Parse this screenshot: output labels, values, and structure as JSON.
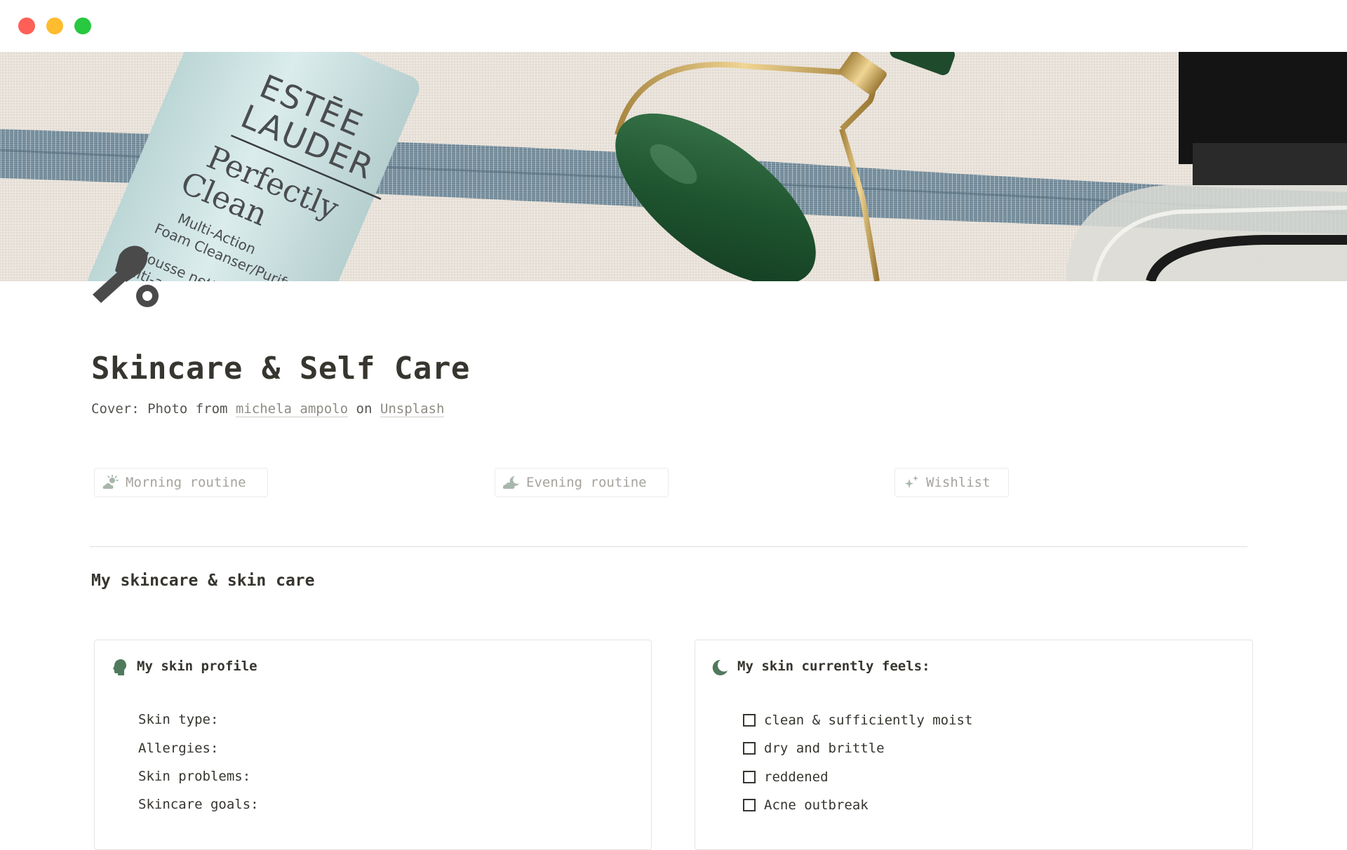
{
  "page": {
    "title": "Skincare & Self Care",
    "caption": {
      "prefix": "Cover: Photo from",
      "author": "michela ampolo",
      "on": "on",
      "source": "Unsplash"
    }
  },
  "cover": {
    "brand_line1": "ESTĒE",
    "brand_line2": "LAUDER",
    "product_line1": "Perfectly",
    "product_line2": "Clean",
    "desc_line1": "Multi-Action",
    "desc_line2": "Foam Cleanser/Purifying M",
    "desc_line3": "Mousse nettoyante",
    "desc_line4": "multi-action/M"
  },
  "links": [
    {
      "label": "Morning routine",
      "icon": "sun-cloud-icon"
    },
    {
      "label": "Evening routine",
      "icon": "moon-cloud-icon"
    },
    {
      "label": "Wishlist",
      "icon": "sparkles-icon"
    }
  ],
  "section": {
    "heading": "My skincare & skin care"
  },
  "skin_profile": {
    "title": "My skin profile",
    "icon": "head-profile-icon",
    "fields": [
      "Skin type:",
      "Allergies:",
      "Skin problems:",
      "Skincare goals:"
    ]
  },
  "skin_feels": {
    "title": "My skin currently feels:",
    "icon": "crescent-moon-icon",
    "items": [
      "clean & sufficiently moist",
      "dry and brittle",
      "reddened",
      "Acne outbreak"
    ]
  },
  "colors": {
    "accent_green": "#4f7a5c",
    "text": "#37352f",
    "muted": "#a6a39d"
  }
}
